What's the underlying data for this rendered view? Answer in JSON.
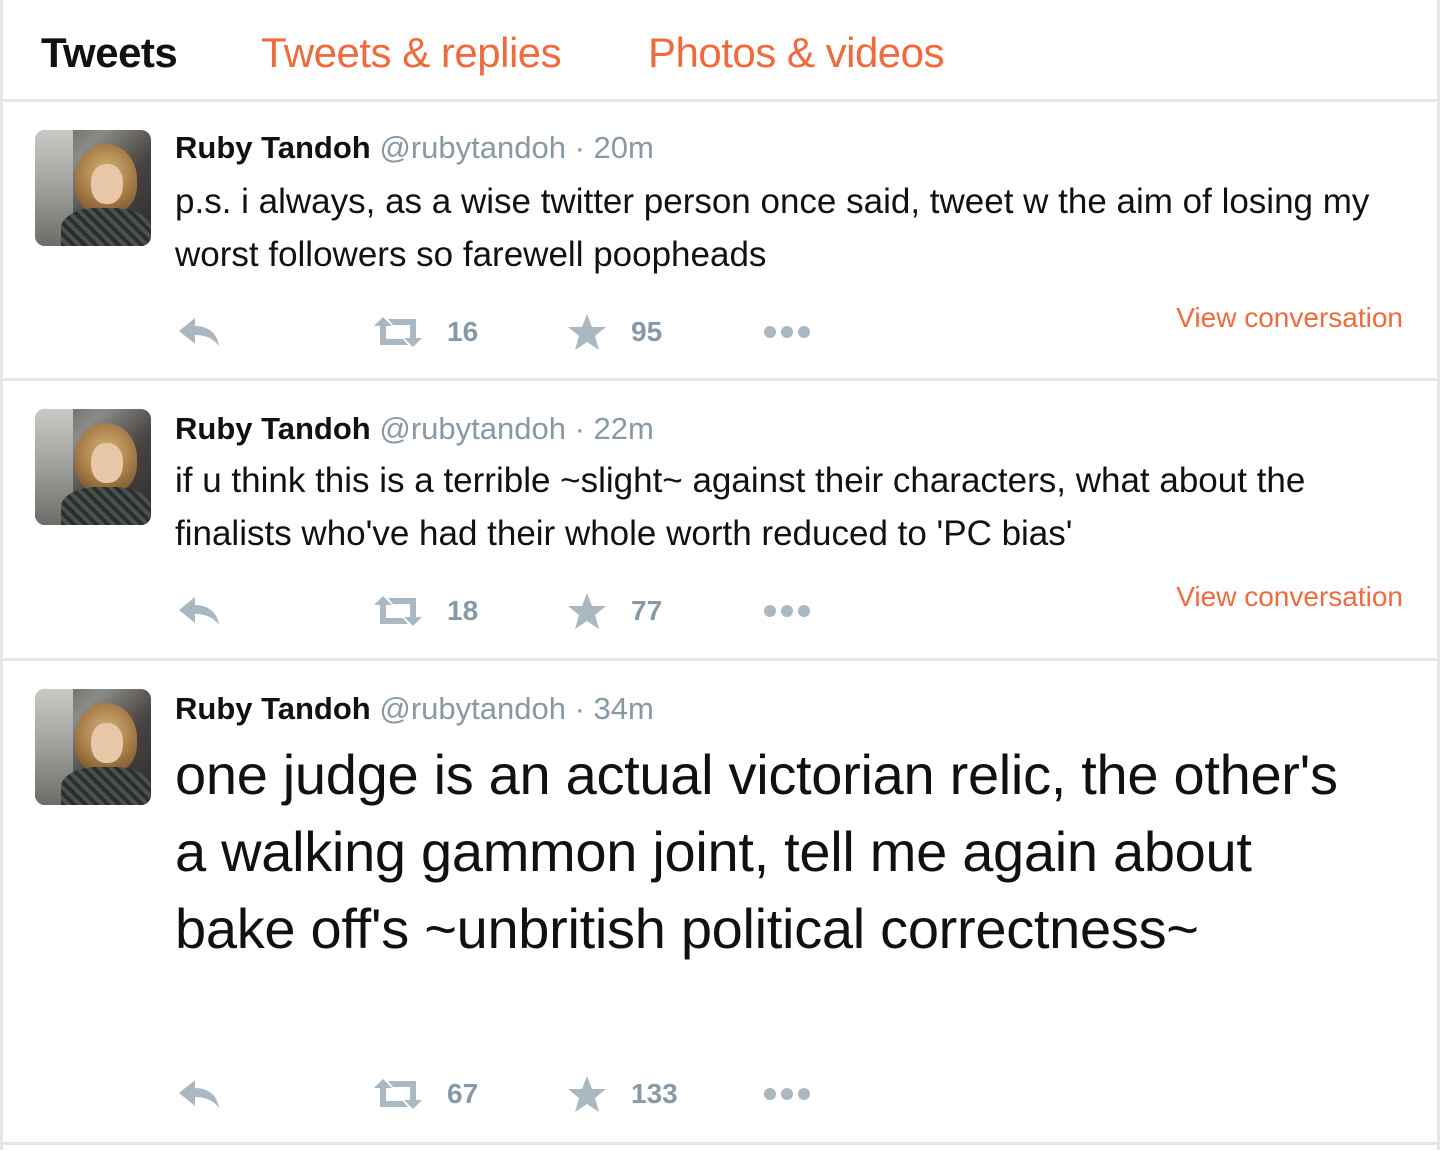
{
  "tabs": [
    {
      "label": "Tweets"
    },
    {
      "label": "Tweets & replies"
    },
    {
      "label": "Photos & videos"
    }
  ],
  "tweets": [
    {
      "name": "Ruby Tandoh",
      "handle": "@rubytandoh",
      "separator": "·",
      "time": "20m",
      "text": "p.s. i always, as a wise twitter person once said, tweet w the aim of losing my worst followers so farewell poopheads",
      "retweets": "16",
      "favorites": "95",
      "view_conversation": "View conversation"
    },
    {
      "name": "Ruby Tandoh",
      "handle": "@rubytandoh",
      "separator": "·",
      "time": "22m",
      "text": "if u think this is a terrible ~slight~ against their characters, what about the finalists who've had their whole worth reduced to 'PC bias'",
      "retweets": "18",
      "favorites": "77",
      "view_conversation": "View conversation"
    },
    {
      "name": "Ruby Tandoh",
      "handle": "@rubytandoh",
      "separator": "·",
      "time": "34m",
      "text": "one judge is an actual victorian relic, the other's a walking gammon joint, tell me again about bake off's ~unbritish political correctness~",
      "retweets": "67",
      "favorites": "133"
    }
  ],
  "icons": {
    "reply": "reply-icon",
    "retweet": "retweet-icon",
    "favorite": "star-icon",
    "more": "more-dots-icon"
  },
  "colors": {
    "accent": "#ef6a3d",
    "muted": "#8899a6",
    "icon": "#aab8c2",
    "divider": "#e3e7ea"
  }
}
